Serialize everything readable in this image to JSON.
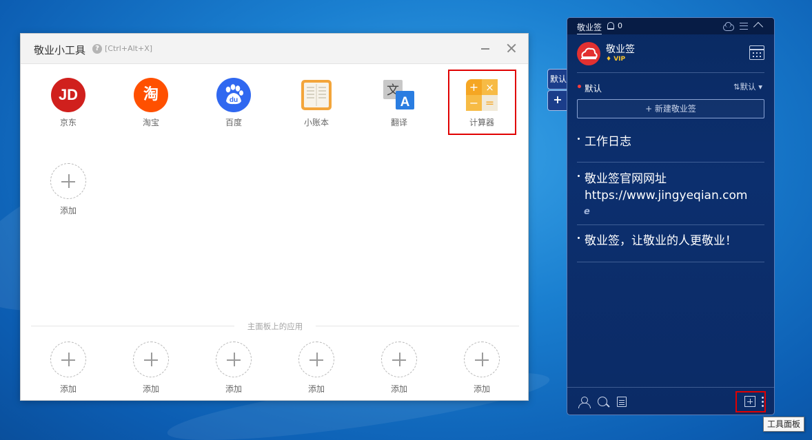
{
  "tools_window": {
    "title": "敬业小工具",
    "help_glyph": "?",
    "shortcut": "[Ctrl+Alt+X]",
    "apps": [
      {
        "label": "京东",
        "glyph": "JD",
        "icon": "jd-icon"
      },
      {
        "label": "淘宝",
        "glyph": "淘",
        "icon": "taobao-icon"
      },
      {
        "label": "百度",
        "glyph": "du",
        "icon": "baidu-paw-icon"
      },
      {
        "label": "小账本",
        "icon": "ledger-book-icon"
      },
      {
        "label": "翻译",
        "glyph_a": "文",
        "glyph_b": "A",
        "icon": "translate-icon"
      },
      {
        "label": "计算器",
        "glyphs": [
          "+",
          "×",
          "−",
          "="
        ],
        "icon": "calculator-icon"
      }
    ],
    "add_label": "添加",
    "main_panel_divider": "主面板上的应用",
    "panel_add_slots": [
      "添加",
      "添加",
      "添加",
      "添加",
      "添加",
      "添加"
    ]
  },
  "side_tabs": {
    "default_label": "默认",
    "add_label": "+"
  },
  "notes_panel": {
    "topbar_title": "敬业签",
    "notification_count": "0",
    "username": "敬业签",
    "vip": "VIP",
    "category": "默认",
    "sort_label": "⇅默认",
    "new_note_button": "+ 新建敬业签",
    "notes": [
      {
        "text": "工作日志"
      },
      {
        "text": "敬业签官网网址\nhttps://www.jingyeqian.com"
      },
      {
        "text": "敬业签，让敬业的人更敬业！"
      }
    ],
    "ie_glyph": "e",
    "tooltip": "工具面板"
  },
  "colors": {
    "accent_red": "#e00000",
    "panel_bg": "#0c2f6e",
    "jd": "#d0201d",
    "taobao": "#ff5000",
    "baidu": "#3068f0",
    "calculator": "#f5a623"
  }
}
